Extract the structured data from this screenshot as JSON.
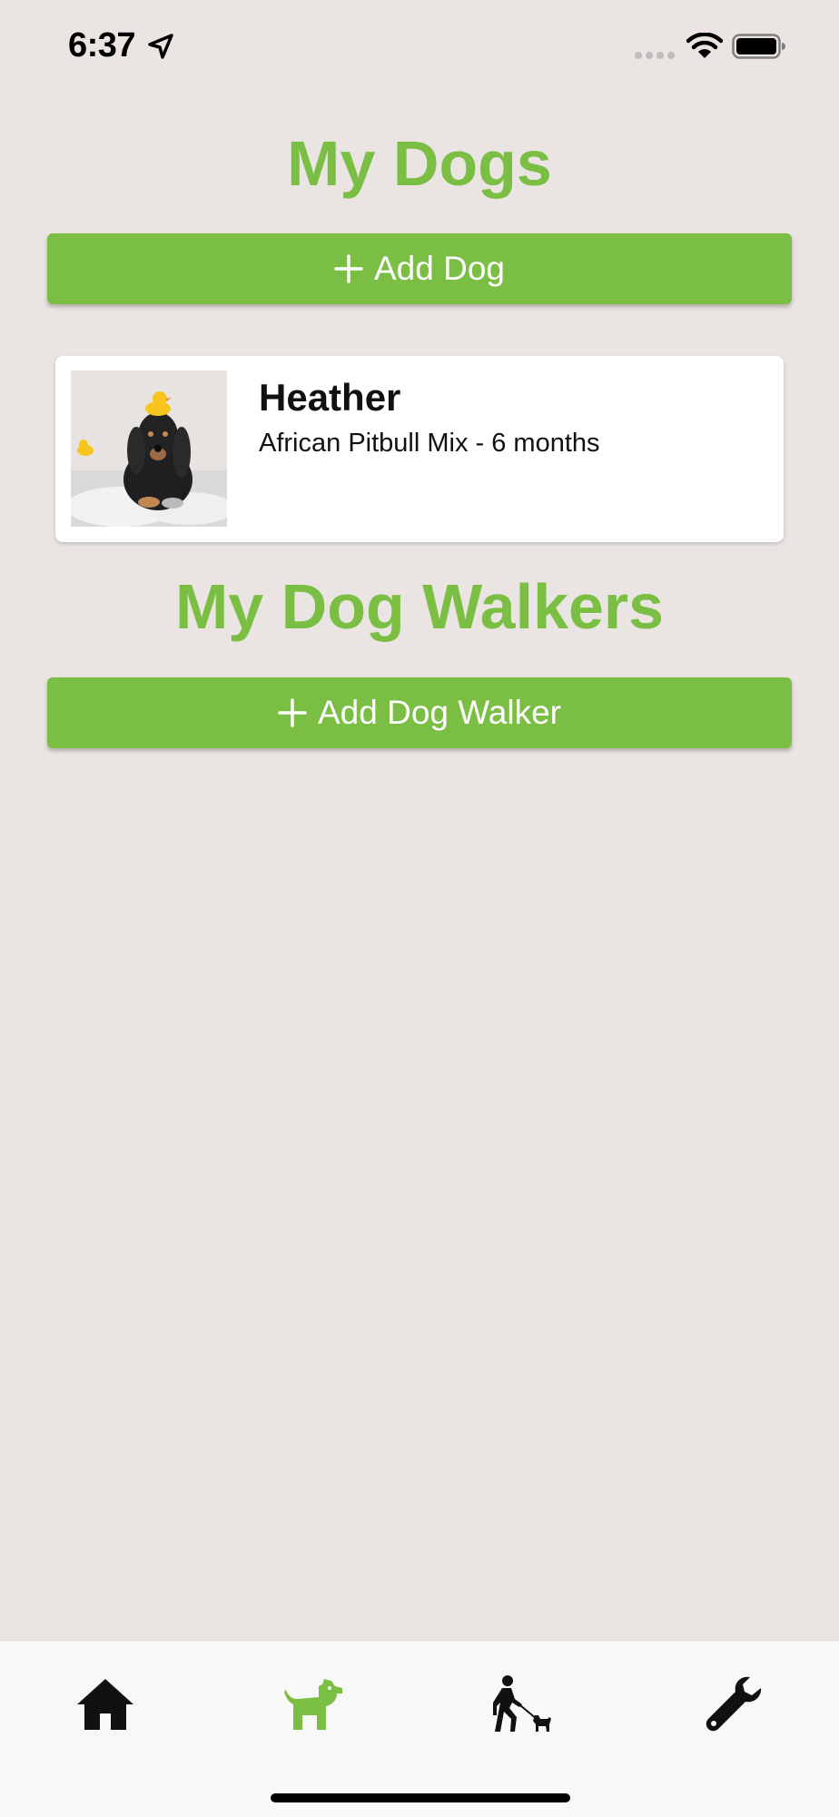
{
  "status_bar": {
    "time": "6:37"
  },
  "my_dogs": {
    "title": "My Dogs",
    "add_button_label": "Add Dog",
    "dogs": [
      {
        "name": "Heather",
        "details": "African Pitbull Mix - 6 months",
        "photo": "dachshund-with-rubber-duck-photo"
      }
    ]
  },
  "my_walkers": {
    "title": "My Dog Walkers",
    "add_button_label": "Add Dog Walker"
  },
  "tab_bar": {
    "tabs": [
      {
        "icon": "home-icon",
        "active": false
      },
      {
        "icon": "dog-icon",
        "active": true
      },
      {
        "icon": "dog-walker-icon",
        "active": false
      },
      {
        "icon": "wrench-icon",
        "active": false
      }
    ]
  },
  "colors": {
    "accent": "#7BBE44",
    "background": "#EAE5E2",
    "tab_inactive": "#111111"
  }
}
